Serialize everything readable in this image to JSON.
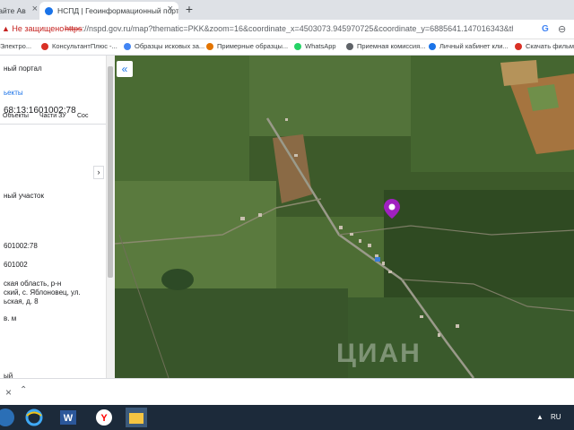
{
  "browser": {
    "tabs": [
      {
        "label": "сайте Ав",
        "active": false
      },
      {
        "label": "НСПД | Геоинформационный порт",
        "active": true
      }
    ],
    "new_tab_label": "+",
    "security_label": "Не защищено",
    "url_https": "https",
    "url_rest": "://nspd.gov.ru/map?thematic=PKK&zoom=16&coordinate_x=4503073.945970725&coordinate_y=6885641.147016343&theme_id...",
    "bookmarks": [
      {
        "label": "Электро...",
        "color": "#1a73e8"
      },
      {
        "label": "КонсультантПлюс -...",
        "color": "#d93025"
      },
      {
        "label": "Образцы исковых за...",
        "color": "#4285f4"
      },
      {
        "label": "Примерные образцы...",
        "color": "#e37400"
      },
      {
        "label": "WhatsApp",
        "color": "#25d366"
      },
      {
        "label": "Приемная комиссия...",
        "color": "#5f6368"
      },
      {
        "label": "Личный кабинет кли...",
        "color": "#1a73e8"
      },
      {
        "label": "Скачать фильмы",
        "color": "#d93025"
      }
    ]
  },
  "sidebar": {
    "portal_title": "ный портал",
    "objects_link": "ьекты",
    "cad_number_top": "68:13:1601002:78",
    "tabs": [
      "Объекты",
      "Части ЗУ",
      "Сос"
    ],
    "tab_arrow": "›",
    "type": "ный участок",
    "cad_number": "601002:78",
    "quarter": "601002",
    "address_lines": [
      "ская область, р-н",
      "ский, с. Яблоновец, ул.",
      "ьская, д. 8"
    ],
    "area_unit": "в. м",
    "bottom_fragment": "ый"
  },
  "map": {
    "collapse_label": "«",
    "watermark": "ЦИАН"
  },
  "downloads": {
    "close_label": "×",
    "up_label": "⌃"
  },
  "taskbar": {
    "lang": "RU",
    "tray": "▲"
  }
}
